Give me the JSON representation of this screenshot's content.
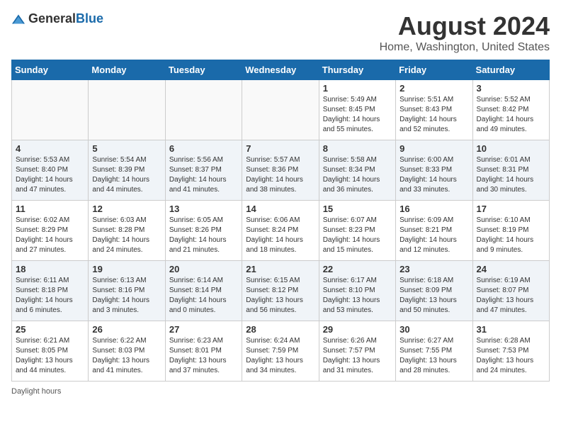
{
  "header": {
    "logo_general": "General",
    "logo_blue": "Blue",
    "title": "August 2024",
    "subtitle": "Home, Washington, United States"
  },
  "days": [
    "Sunday",
    "Monday",
    "Tuesday",
    "Wednesday",
    "Thursday",
    "Friday",
    "Saturday"
  ],
  "footer": {
    "daylight_label": "Daylight hours"
  },
  "weeks": [
    [
      {
        "day": "",
        "content": ""
      },
      {
        "day": "",
        "content": ""
      },
      {
        "day": "",
        "content": ""
      },
      {
        "day": "",
        "content": ""
      },
      {
        "day": "1",
        "content": "Sunrise: 5:49 AM\nSunset: 8:45 PM\nDaylight: 14 hours\nand 55 minutes."
      },
      {
        "day": "2",
        "content": "Sunrise: 5:51 AM\nSunset: 8:43 PM\nDaylight: 14 hours\nand 52 minutes."
      },
      {
        "day": "3",
        "content": "Sunrise: 5:52 AM\nSunset: 8:42 PM\nDaylight: 14 hours\nand 49 minutes."
      }
    ],
    [
      {
        "day": "4",
        "content": "Sunrise: 5:53 AM\nSunset: 8:40 PM\nDaylight: 14 hours\nand 47 minutes."
      },
      {
        "day": "5",
        "content": "Sunrise: 5:54 AM\nSunset: 8:39 PM\nDaylight: 14 hours\nand 44 minutes."
      },
      {
        "day": "6",
        "content": "Sunrise: 5:56 AM\nSunset: 8:37 PM\nDaylight: 14 hours\nand 41 minutes."
      },
      {
        "day": "7",
        "content": "Sunrise: 5:57 AM\nSunset: 8:36 PM\nDaylight: 14 hours\nand 38 minutes."
      },
      {
        "day": "8",
        "content": "Sunrise: 5:58 AM\nSunset: 8:34 PM\nDaylight: 14 hours\nand 36 minutes."
      },
      {
        "day": "9",
        "content": "Sunrise: 6:00 AM\nSunset: 8:33 PM\nDaylight: 14 hours\nand 33 minutes."
      },
      {
        "day": "10",
        "content": "Sunrise: 6:01 AM\nSunset: 8:31 PM\nDaylight: 14 hours\nand 30 minutes."
      }
    ],
    [
      {
        "day": "11",
        "content": "Sunrise: 6:02 AM\nSunset: 8:29 PM\nDaylight: 14 hours\nand 27 minutes."
      },
      {
        "day": "12",
        "content": "Sunrise: 6:03 AM\nSunset: 8:28 PM\nDaylight: 14 hours\nand 24 minutes."
      },
      {
        "day": "13",
        "content": "Sunrise: 6:05 AM\nSunset: 8:26 PM\nDaylight: 14 hours\nand 21 minutes."
      },
      {
        "day": "14",
        "content": "Sunrise: 6:06 AM\nSunset: 8:24 PM\nDaylight: 14 hours\nand 18 minutes."
      },
      {
        "day": "15",
        "content": "Sunrise: 6:07 AM\nSunset: 8:23 PM\nDaylight: 14 hours\nand 15 minutes."
      },
      {
        "day": "16",
        "content": "Sunrise: 6:09 AM\nSunset: 8:21 PM\nDaylight: 14 hours\nand 12 minutes."
      },
      {
        "day": "17",
        "content": "Sunrise: 6:10 AM\nSunset: 8:19 PM\nDaylight: 14 hours\nand 9 minutes."
      }
    ],
    [
      {
        "day": "18",
        "content": "Sunrise: 6:11 AM\nSunset: 8:18 PM\nDaylight: 14 hours\nand 6 minutes."
      },
      {
        "day": "19",
        "content": "Sunrise: 6:13 AM\nSunset: 8:16 PM\nDaylight: 14 hours\nand 3 minutes."
      },
      {
        "day": "20",
        "content": "Sunrise: 6:14 AM\nSunset: 8:14 PM\nDaylight: 14 hours\nand 0 minutes."
      },
      {
        "day": "21",
        "content": "Sunrise: 6:15 AM\nSunset: 8:12 PM\nDaylight: 13 hours\nand 56 minutes."
      },
      {
        "day": "22",
        "content": "Sunrise: 6:17 AM\nSunset: 8:10 PM\nDaylight: 13 hours\nand 53 minutes."
      },
      {
        "day": "23",
        "content": "Sunrise: 6:18 AM\nSunset: 8:09 PM\nDaylight: 13 hours\nand 50 minutes."
      },
      {
        "day": "24",
        "content": "Sunrise: 6:19 AM\nSunset: 8:07 PM\nDaylight: 13 hours\nand 47 minutes."
      }
    ],
    [
      {
        "day": "25",
        "content": "Sunrise: 6:21 AM\nSunset: 8:05 PM\nDaylight: 13 hours\nand 44 minutes."
      },
      {
        "day": "26",
        "content": "Sunrise: 6:22 AM\nSunset: 8:03 PM\nDaylight: 13 hours\nand 41 minutes."
      },
      {
        "day": "27",
        "content": "Sunrise: 6:23 AM\nSunset: 8:01 PM\nDaylight: 13 hours\nand 37 minutes."
      },
      {
        "day": "28",
        "content": "Sunrise: 6:24 AM\nSunset: 7:59 PM\nDaylight: 13 hours\nand 34 minutes."
      },
      {
        "day": "29",
        "content": "Sunrise: 6:26 AM\nSunset: 7:57 PM\nDaylight: 13 hours\nand 31 minutes."
      },
      {
        "day": "30",
        "content": "Sunrise: 6:27 AM\nSunset: 7:55 PM\nDaylight: 13 hours\nand 28 minutes."
      },
      {
        "day": "31",
        "content": "Sunrise: 6:28 AM\nSunset: 7:53 PM\nDaylight: 13 hours\nand 24 minutes."
      }
    ]
  ]
}
